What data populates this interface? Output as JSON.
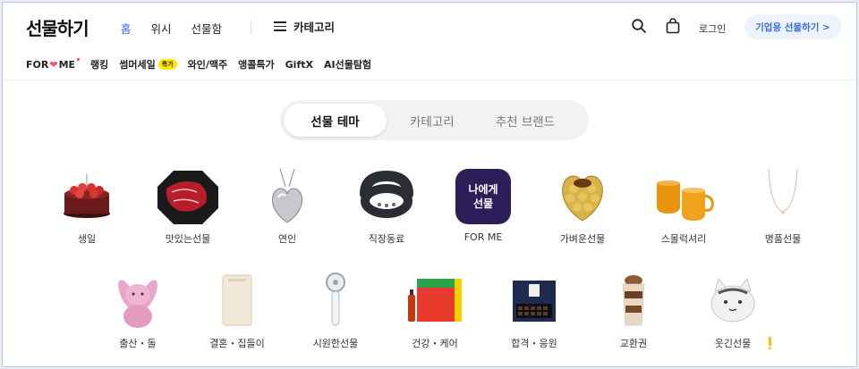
{
  "header": {
    "logo": "선물하기",
    "nav": [
      "홈",
      "위시",
      "선물함"
    ],
    "category": "카테고리",
    "login": "로그인",
    "business": "기업용 선물하기 >"
  },
  "subnav": {
    "forme_left": "FOR",
    "forme_right": "ME",
    "ranking": "랭킹",
    "summer_sale": "썸머세일",
    "summer_badge": "특가",
    "wine": "와인/맥주",
    "encore": "앵콜특가",
    "giftx": "GiftX",
    "ai": "AI선물탐험"
  },
  "tabs": [
    "선물 테마",
    "카테고리",
    "추천 브랜드"
  ],
  "themes_row1": [
    {
      "label": "생일",
      "icon": "birthday-cake-icon"
    },
    {
      "label": "맛있는선물",
      "icon": "beef-icon"
    },
    {
      "label": "연인",
      "icon": "heart-necklace-icon"
    },
    {
      "label": "직장동료",
      "icon": "neck-fan-icon"
    },
    {
      "label": "FOR ME",
      "icon": "for-me-tile-icon",
      "tile_text_1": "나에게",
      "tile_text_2": "선물"
    },
    {
      "label": "가벼운선물",
      "icon": "chocolate-box-icon"
    },
    {
      "label": "스몰럭셔리",
      "icon": "mugs-icon"
    },
    {
      "label": "명품선물",
      "icon": "necklace-icon"
    }
  ],
  "themes_row2": [
    {
      "label": "출산・돌",
      "icon": "bunny-doll-icon"
    },
    {
      "label": "결혼・집들이",
      "icon": "purifier-icon"
    },
    {
      "label": "시원한선물",
      "icon": "handy-fan-icon"
    },
    {
      "label": "건강・케어",
      "icon": "energy-drink-icon"
    },
    {
      "label": "합격・응원",
      "icon": "snack-box-icon"
    },
    {
      "label": "교환권",
      "icon": "parfait-icon"
    },
    {
      "label": "웃긴선물",
      "icon": "cat-plush-icon"
    }
  ],
  "colors": {
    "accent": "#3b6fe3",
    "badge": "#ffe600",
    "for_me_tile": "#2d1e5a"
  }
}
